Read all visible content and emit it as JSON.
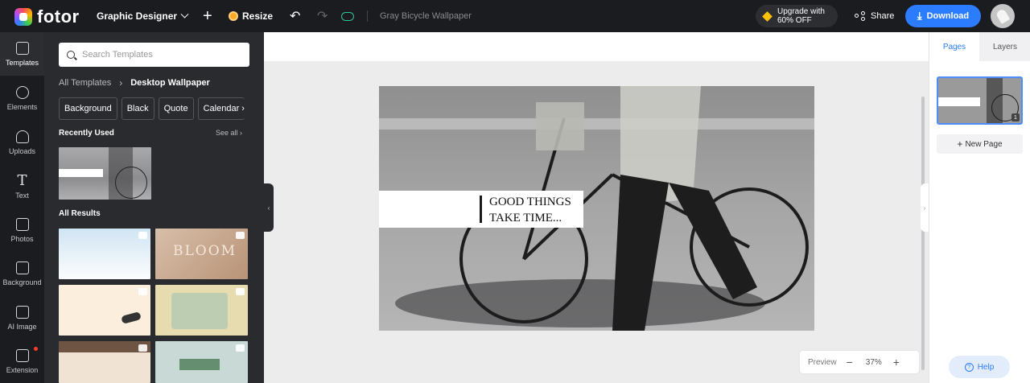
{
  "topbar": {
    "logo_text": "fotor",
    "design_type": "Graphic Designer",
    "resize_label": "Resize",
    "document_title": "Gray Bicycle Wallpaper",
    "upgrade_line1": "Upgrade with",
    "upgrade_line2": "60% OFF",
    "share_label": "Share",
    "download_label": "Download"
  },
  "nav": {
    "items": [
      {
        "label": "Templates",
        "icon": "templates-icon",
        "active": true
      },
      {
        "label": "Elements",
        "icon": "elements-icon"
      },
      {
        "label": "Uploads",
        "icon": "uploads-icon"
      },
      {
        "label": "Text",
        "icon": "text-icon"
      },
      {
        "label": "Photos",
        "icon": "photos-icon"
      },
      {
        "label": "Background",
        "icon": "background-icon"
      },
      {
        "label": "AI Image",
        "icon": "ai-image-icon"
      },
      {
        "label": "Extension",
        "icon": "extension-icon",
        "badge": true
      }
    ]
  },
  "panel": {
    "search_placeholder": "Search Templates",
    "breadcrumb_all": "All Templates",
    "breadcrumb_current": "Desktop Wallpaper",
    "chips": [
      "Background",
      "Black",
      "Quote",
      "Calendar"
    ],
    "recently_used": "Recently Used",
    "see_all": "See all",
    "all_results": "All Results",
    "bloom_text": "BLOOM"
  },
  "canvas": {
    "quote_text": "GOOD THINGS\nTAKE TIME...",
    "zoom_preview": "Preview",
    "zoom_value": "37%"
  },
  "rightpanel": {
    "tab_pages": "Pages",
    "tab_layers": "Layers",
    "page_number": "1",
    "new_page": "New Page",
    "help": "Help"
  },
  "colors": {
    "accent": "#2b7cff",
    "dark_bg": "#1b1c1f",
    "panel_bg": "#2a2b2f"
  }
}
